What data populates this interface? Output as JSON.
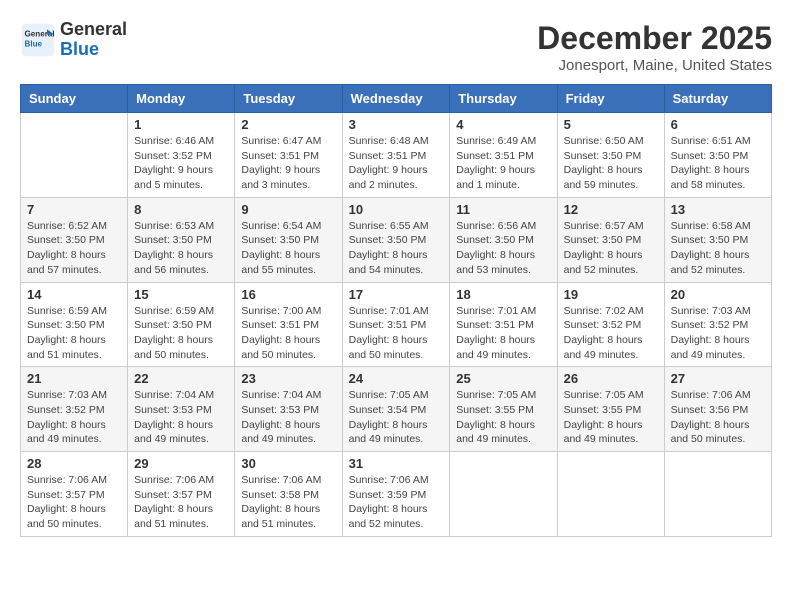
{
  "header": {
    "logo_line1": "General",
    "logo_line2": "Blue",
    "month": "December 2025",
    "location": "Jonesport, Maine, United States"
  },
  "weekdays": [
    "Sunday",
    "Monday",
    "Tuesday",
    "Wednesday",
    "Thursday",
    "Friday",
    "Saturday"
  ],
  "weeks": [
    [
      {
        "day": "",
        "info": ""
      },
      {
        "day": "1",
        "info": "Sunrise: 6:46 AM\nSunset: 3:52 PM\nDaylight: 9 hours\nand 5 minutes."
      },
      {
        "day": "2",
        "info": "Sunrise: 6:47 AM\nSunset: 3:51 PM\nDaylight: 9 hours\nand 3 minutes."
      },
      {
        "day": "3",
        "info": "Sunrise: 6:48 AM\nSunset: 3:51 PM\nDaylight: 9 hours\nand 2 minutes."
      },
      {
        "day": "4",
        "info": "Sunrise: 6:49 AM\nSunset: 3:51 PM\nDaylight: 9 hours\nand 1 minute."
      },
      {
        "day": "5",
        "info": "Sunrise: 6:50 AM\nSunset: 3:50 PM\nDaylight: 8 hours\nand 59 minutes."
      },
      {
        "day": "6",
        "info": "Sunrise: 6:51 AM\nSunset: 3:50 PM\nDaylight: 8 hours\nand 58 minutes."
      }
    ],
    [
      {
        "day": "7",
        "info": "Sunrise: 6:52 AM\nSunset: 3:50 PM\nDaylight: 8 hours\nand 57 minutes."
      },
      {
        "day": "8",
        "info": "Sunrise: 6:53 AM\nSunset: 3:50 PM\nDaylight: 8 hours\nand 56 minutes."
      },
      {
        "day": "9",
        "info": "Sunrise: 6:54 AM\nSunset: 3:50 PM\nDaylight: 8 hours\nand 55 minutes."
      },
      {
        "day": "10",
        "info": "Sunrise: 6:55 AM\nSunset: 3:50 PM\nDaylight: 8 hours\nand 54 minutes."
      },
      {
        "day": "11",
        "info": "Sunrise: 6:56 AM\nSunset: 3:50 PM\nDaylight: 8 hours\nand 53 minutes."
      },
      {
        "day": "12",
        "info": "Sunrise: 6:57 AM\nSunset: 3:50 PM\nDaylight: 8 hours\nand 52 minutes."
      },
      {
        "day": "13",
        "info": "Sunrise: 6:58 AM\nSunset: 3:50 PM\nDaylight: 8 hours\nand 52 minutes."
      }
    ],
    [
      {
        "day": "14",
        "info": "Sunrise: 6:59 AM\nSunset: 3:50 PM\nDaylight: 8 hours\nand 51 minutes."
      },
      {
        "day": "15",
        "info": "Sunrise: 6:59 AM\nSunset: 3:50 PM\nDaylight: 8 hours\nand 50 minutes."
      },
      {
        "day": "16",
        "info": "Sunrise: 7:00 AM\nSunset: 3:51 PM\nDaylight: 8 hours\nand 50 minutes."
      },
      {
        "day": "17",
        "info": "Sunrise: 7:01 AM\nSunset: 3:51 PM\nDaylight: 8 hours\nand 50 minutes."
      },
      {
        "day": "18",
        "info": "Sunrise: 7:01 AM\nSunset: 3:51 PM\nDaylight: 8 hours\nand 49 minutes."
      },
      {
        "day": "19",
        "info": "Sunrise: 7:02 AM\nSunset: 3:52 PM\nDaylight: 8 hours\nand 49 minutes."
      },
      {
        "day": "20",
        "info": "Sunrise: 7:03 AM\nSunset: 3:52 PM\nDaylight: 8 hours\nand 49 minutes."
      }
    ],
    [
      {
        "day": "21",
        "info": "Sunrise: 7:03 AM\nSunset: 3:52 PM\nDaylight: 8 hours\nand 49 minutes."
      },
      {
        "day": "22",
        "info": "Sunrise: 7:04 AM\nSunset: 3:53 PM\nDaylight: 8 hours\nand 49 minutes."
      },
      {
        "day": "23",
        "info": "Sunrise: 7:04 AM\nSunset: 3:53 PM\nDaylight: 8 hours\nand 49 minutes."
      },
      {
        "day": "24",
        "info": "Sunrise: 7:05 AM\nSunset: 3:54 PM\nDaylight: 8 hours\nand 49 minutes."
      },
      {
        "day": "25",
        "info": "Sunrise: 7:05 AM\nSunset: 3:55 PM\nDaylight: 8 hours\nand 49 minutes."
      },
      {
        "day": "26",
        "info": "Sunrise: 7:05 AM\nSunset: 3:55 PM\nDaylight: 8 hours\nand 49 minutes."
      },
      {
        "day": "27",
        "info": "Sunrise: 7:06 AM\nSunset: 3:56 PM\nDaylight: 8 hours\nand 50 minutes."
      }
    ],
    [
      {
        "day": "28",
        "info": "Sunrise: 7:06 AM\nSunset: 3:57 PM\nDaylight: 8 hours\nand 50 minutes."
      },
      {
        "day": "29",
        "info": "Sunrise: 7:06 AM\nSunset: 3:57 PM\nDaylight: 8 hours\nand 51 minutes."
      },
      {
        "day": "30",
        "info": "Sunrise: 7:06 AM\nSunset: 3:58 PM\nDaylight: 8 hours\nand 51 minutes."
      },
      {
        "day": "31",
        "info": "Sunrise: 7:06 AM\nSunset: 3:59 PM\nDaylight: 8 hours\nand 52 minutes."
      },
      {
        "day": "",
        "info": ""
      },
      {
        "day": "",
        "info": ""
      },
      {
        "day": "",
        "info": ""
      }
    ]
  ]
}
